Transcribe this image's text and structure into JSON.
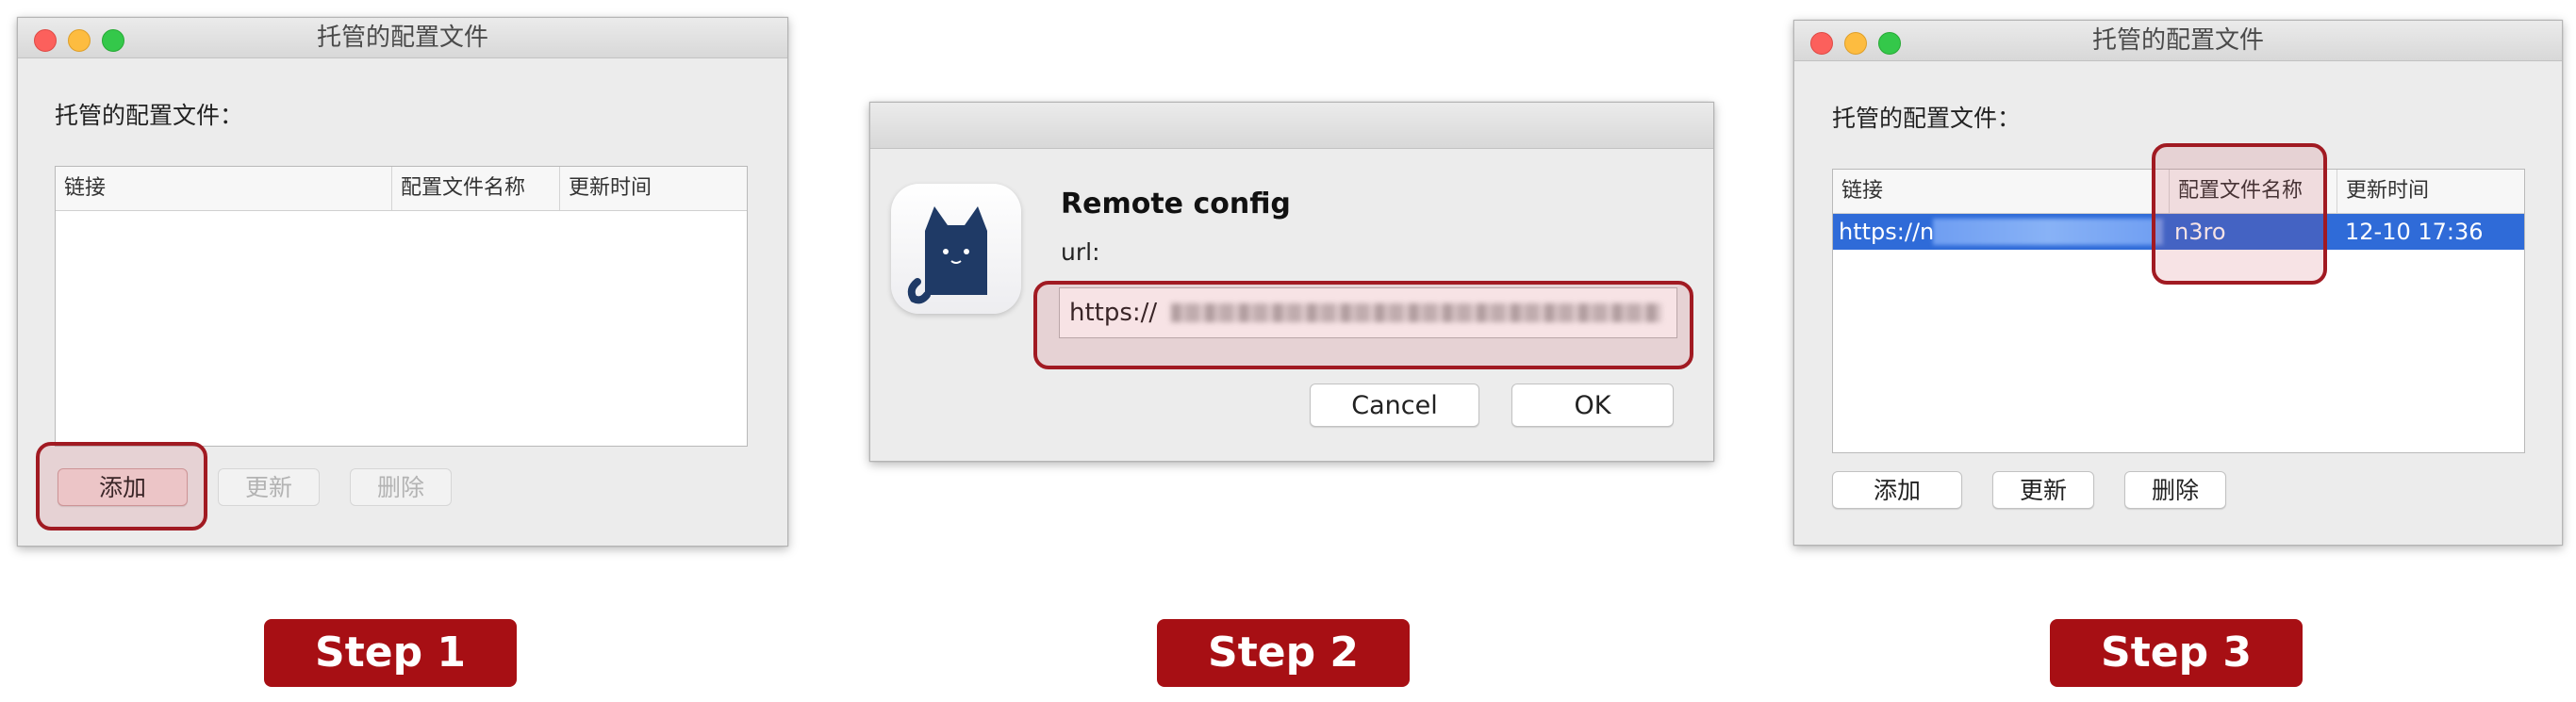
{
  "step1": {
    "window_title": "托管的配置文件",
    "section_label": "托管的配置文件：",
    "columns": [
      "链接",
      "配置文件名称",
      "更新时间"
    ],
    "buttons": {
      "add": "添加",
      "update": "更新",
      "delete": "删除"
    }
  },
  "step2": {
    "dialog_title": "Remote config",
    "url_label": "url:",
    "url_value": "https://",
    "buttons": {
      "cancel": "Cancel",
      "ok": "OK"
    }
  },
  "step3": {
    "window_title": "托管的配置文件",
    "section_label": "托管的配置文件：",
    "columns": [
      "链接",
      "配置文件名称",
      "更新时间"
    ],
    "row": {
      "link": "https://n",
      "name": "n3ro",
      "updated": "12-10 17:36"
    },
    "buttons": {
      "add": "添加",
      "update": "更新",
      "delete": "删除"
    }
  },
  "steps": [
    "Step 1",
    "Step 2",
    "Step 3"
  ],
  "colors": {
    "accent": "#a70f14",
    "selection": "#2f6bd8"
  },
  "icons": {
    "app_icon": "cat-icon"
  }
}
